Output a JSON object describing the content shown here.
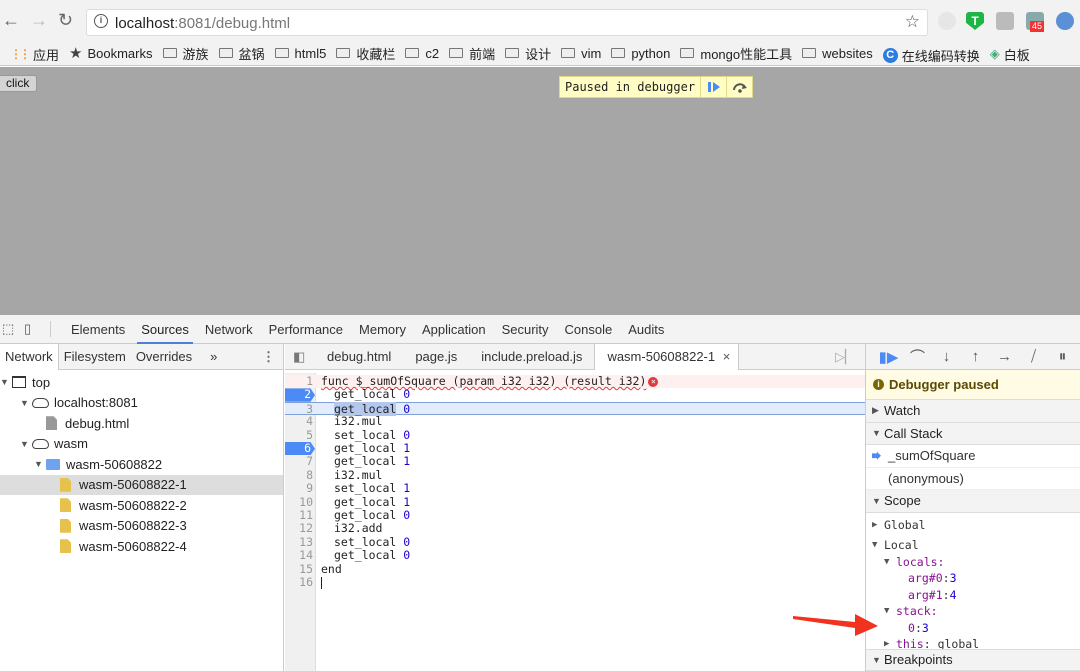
{
  "browser": {
    "url_host": "localhost",
    "url_rest": ":8081/debug.html",
    "extension_badge": "45",
    "bookmarks": [
      {
        "label": "应用",
        "icon": "apps-grid-icon"
      },
      {
        "label": "Bookmarks",
        "icon": "star-icon"
      },
      {
        "label": "游族",
        "icon": "folder-icon"
      },
      {
        "label": "盆锅",
        "icon": "folder-icon"
      },
      {
        "label": "html5",
        "icon": "folder-icon"
      },
      {
        "label": "收藏栏",
        "icon": "folder-icon"
      },
      {
        "label": "c2",
        "icon": "folder-icon"
      },
      {
        "label": "前端",
        "icon": "folder-icon"
      },
      {
        "label": "设计",
        "icon": "folder-icon"
      },
      {
        "label": "vim",
        "icon": "folder-icon"
      },
      {
        "label": "python",
        "icon": "folder-icon"
      },
      {
        "label": "mongo性能工具",
        "icon": "folder-icon"
      },
      {
        "label": "websites",
        "icon": "folder-icon"
      },
      {
        "label": "在线编码转换",
        "icon": "c-logo-icon"
      },
      {
        "label": "白板",
        "icon": "diamond-icon"
      }
    ]
  },
  "page": {
    "click_button": "click",
    "paused_overlay": "Paused in debugger"
  },
  "devtools": {
    "main_tabs": [
      "Elements",
      "Sources",
      "Network",
      "Performance",
      "Memory",
      "Application",
      "Security",
      "Console",
      "Audits"
    ],
    "active_main_tab": "Sources",
    "navigator_tabs": [
      "Network",
      "Filesystem",
      "Overrides",
      "»"
    ],
    "tree": [
      {
        "label": "top",
        "icon": "frame",
        "depth": 0,
        "expanded": true
      },
      {
        "label": "localhost:8081",
        "icon": "cloud",
        "depth": 1,
        "expanded": true
      },
      {
        "label": "debug.html",
        "icon": "file-gray",
        "depth": 2
      },
      {
        "label": "wasm",
        "icon": "cloud",
        "depth": 1,
        "expanded": true
      },
      {
        "label": "wasm-50608822",
        "icon": "folder",
        "depth": 2,
        "expanded": true
      },
      {
        "label": "wasm-50608822-1",
        "icon": "file-yellow",
        "depth": 3,
        "selected": true
      },
      {
        "label": "wasm-50608822-2",
        "icon": "file-yellow",
        "depth": 3
      },
      {
        "label": "wasm-50608822-3",
        "icon": "file-yellow",
        "depth": 3
      },
      {
        "label": "wasm-50608822-4",
        "icon": "file-yellow",
        "depth": 3
      }
    ],
    "editor_tabs": [
      "debug.html",
      "page.js",
      "include.preload.js",
      "wasm-50608822-1"
    ],
    "active_editor_tab": "wasm-50608822-1",
    "code_lines": [
      {
        "n": "1",
        "op": "func $_sumOfSquare (param i32 i32) (result i32)",
        "arg": "",
        "indent": false,
        "error": true
      },
      {
        "n": "2",
        "op": "get_local",
        "arg": "0",
        "indent": true,
        "breakpoint": true
      },
      {
        "n": "3",
        "op": "get_local",
        "arg": "0",
        "indent": true,
        "current": true
      },
      {
        "n": "4",
        "op": "i32.mul",
        "arg": "",
        "indent": true
      },
      {
        "n": "5",
        "op": "set_local",
        "arg": "0",
        "indent": true
      },
      {
        "n": "6",
        "op": "get_local",
        "arg": "1",
        "indent": true,
        "breakpoint": true
      },
      {
        "n": "7",
        "op": "get_local",
        "arg": "1",
        "indent": true
      },
      {
        "n": "8",
        "op": "i32.mul",
        "arg": "",
        "indent": true
      },
      {
        "n": "9",
        "op": "set_local",
        "arg": "1",
        "indent": true
      },
      {
        "n": "10",
        "op": "get_local",
        "arg": "1",
        "indent": true
      },
      {
        "n": "11",
        "op": "get_local",
        "arg": "0",
        "indent": true
      },
      {
        "n": "12",
        "op": "i32.add",
        "arg": "",
        "indent": true
      },
      {
        "n": "13",
        "op": "set_local",
        "arg": "0",
        "indent": true
      },
      {
        "n": "14",
        "op": "get_local",
        "arg": "0",
        "indent": true
      },
      {
        "n": "15",
        "op": "end",
        "arg": "",
        "indent": false
      },
      {
        "n": "16",
        "op": "",
        "arg": "",
        "indent": false
      }
    ],
    "sidebar": {
      "paused_text": "Debugger paused",
      "watch": "Watch",
      "call_stack": "Call Stack",
      "frames": [
        "_sumOfSquare",
        "(anonymous)"
      ],
      "scope": "Scope",
      "global": "Global",
      "local": "Local",
      "locals_label": "locals:",
      "locals": [
        {
          "k": "arg#0",
          "v": "3"
        },
        {
          "k": "arg#1",
          "v": "4"
        }
      ],
      "stack_label": "stack:",
      "stack": [
        {
          "k": "0",
          "v": "3"
        }
      ],
      "this_key": "this",
      "this_val": "global",
      "breakpoints": "Breakpoints"
    }
  }
}
